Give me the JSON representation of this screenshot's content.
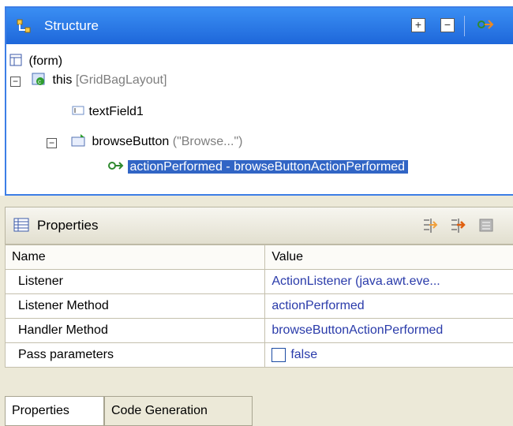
{
  "structure": {
    "title": "Structure",
    "tree": [
      {
        "label": "(form)",
        "sub": ""
      },
      {
        "label": "this",
        "sub": "[GridBagLayout]"
      },
      {
        "label": "textField1",
        "sub": ""
      },
      {
        "label": "browseButton",
        "sub": "(\"Browse...\")"
      },
      {
        "label": "actionPerformed - browseButtonActionPerformed",
        "sub": ""
      }
    ]
  },
  "properties": {
    "title": "Properties",
    "columns": [
      "Name",
      "Value"
    ],
    "rows": [
      {
        "name": "Listener",
        "value": "ActionListener (java.awt.eve..."
      },
      {
        "name": "Listener Method",
        "value": "actionPerformed"
      },
      {
        "name": "Handler Method",
        "value": "browseButtonActionPerformed"
      },
      {
        "name": "Pass parameters",
        "value": "false"
      }
    ],
    "tabs": [
      "Properties",
      "Code Generation"
    ]
  },
  "colors": {
    "header_blue": "#2a7ae8",
    "selection": "#3165c5",
    "value_text": "#2a3baa"
  }
}
